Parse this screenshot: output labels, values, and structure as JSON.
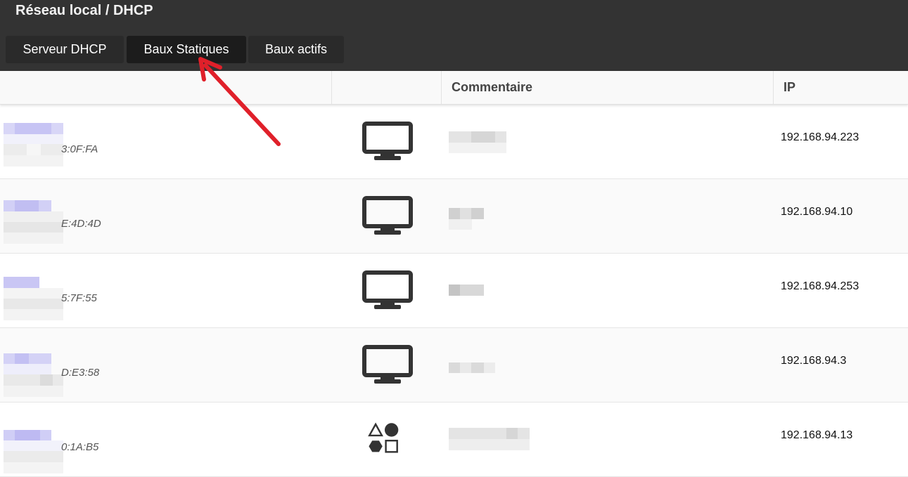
{
  "page": {
    "title": "Réseau local / DHCP"
  },
  "tabs": [
    {
      "label": "Serveur DHCP",
      "active": false
    },
    {
      "label": "Baux Statiques",
      "active": true
    },
    {
      "label": "Baux actifs",
      "active": false
    }
  ],
  "table": {
    "headers": [
      "",
      "",
      "Commentaire",
      "IP"
    ],
    "rows": [
      {
        "mac_suffix": "3:0F:FA",
        "icon": "monitor-icon",
        "ip": "192.168.94.223"
      },
      {
        "mac_suffix": "E:4D:4D",
        "icon": "monitor-icon",
        "ip": "192.168.94.10"
      },
      {
        "mac_suffix": "5:7F:55",
        "icon": "monitor-icon",
        "ip": "192.168.94.253"
      },
      {
        "mac_suffix": "D:E3:58",
        "icon": "monitor-icon",
        "ip": "192.168.94.3"
      },
      {
        "mac_suffix": "0:1A:B5",
        "icon": "shapes-icon",
        "ip": "192.168.94.13"
      }
    ]
  },
  "colors": {
    "topbar": "#333333",
    "arrow": "#e0202a"
  }
}
